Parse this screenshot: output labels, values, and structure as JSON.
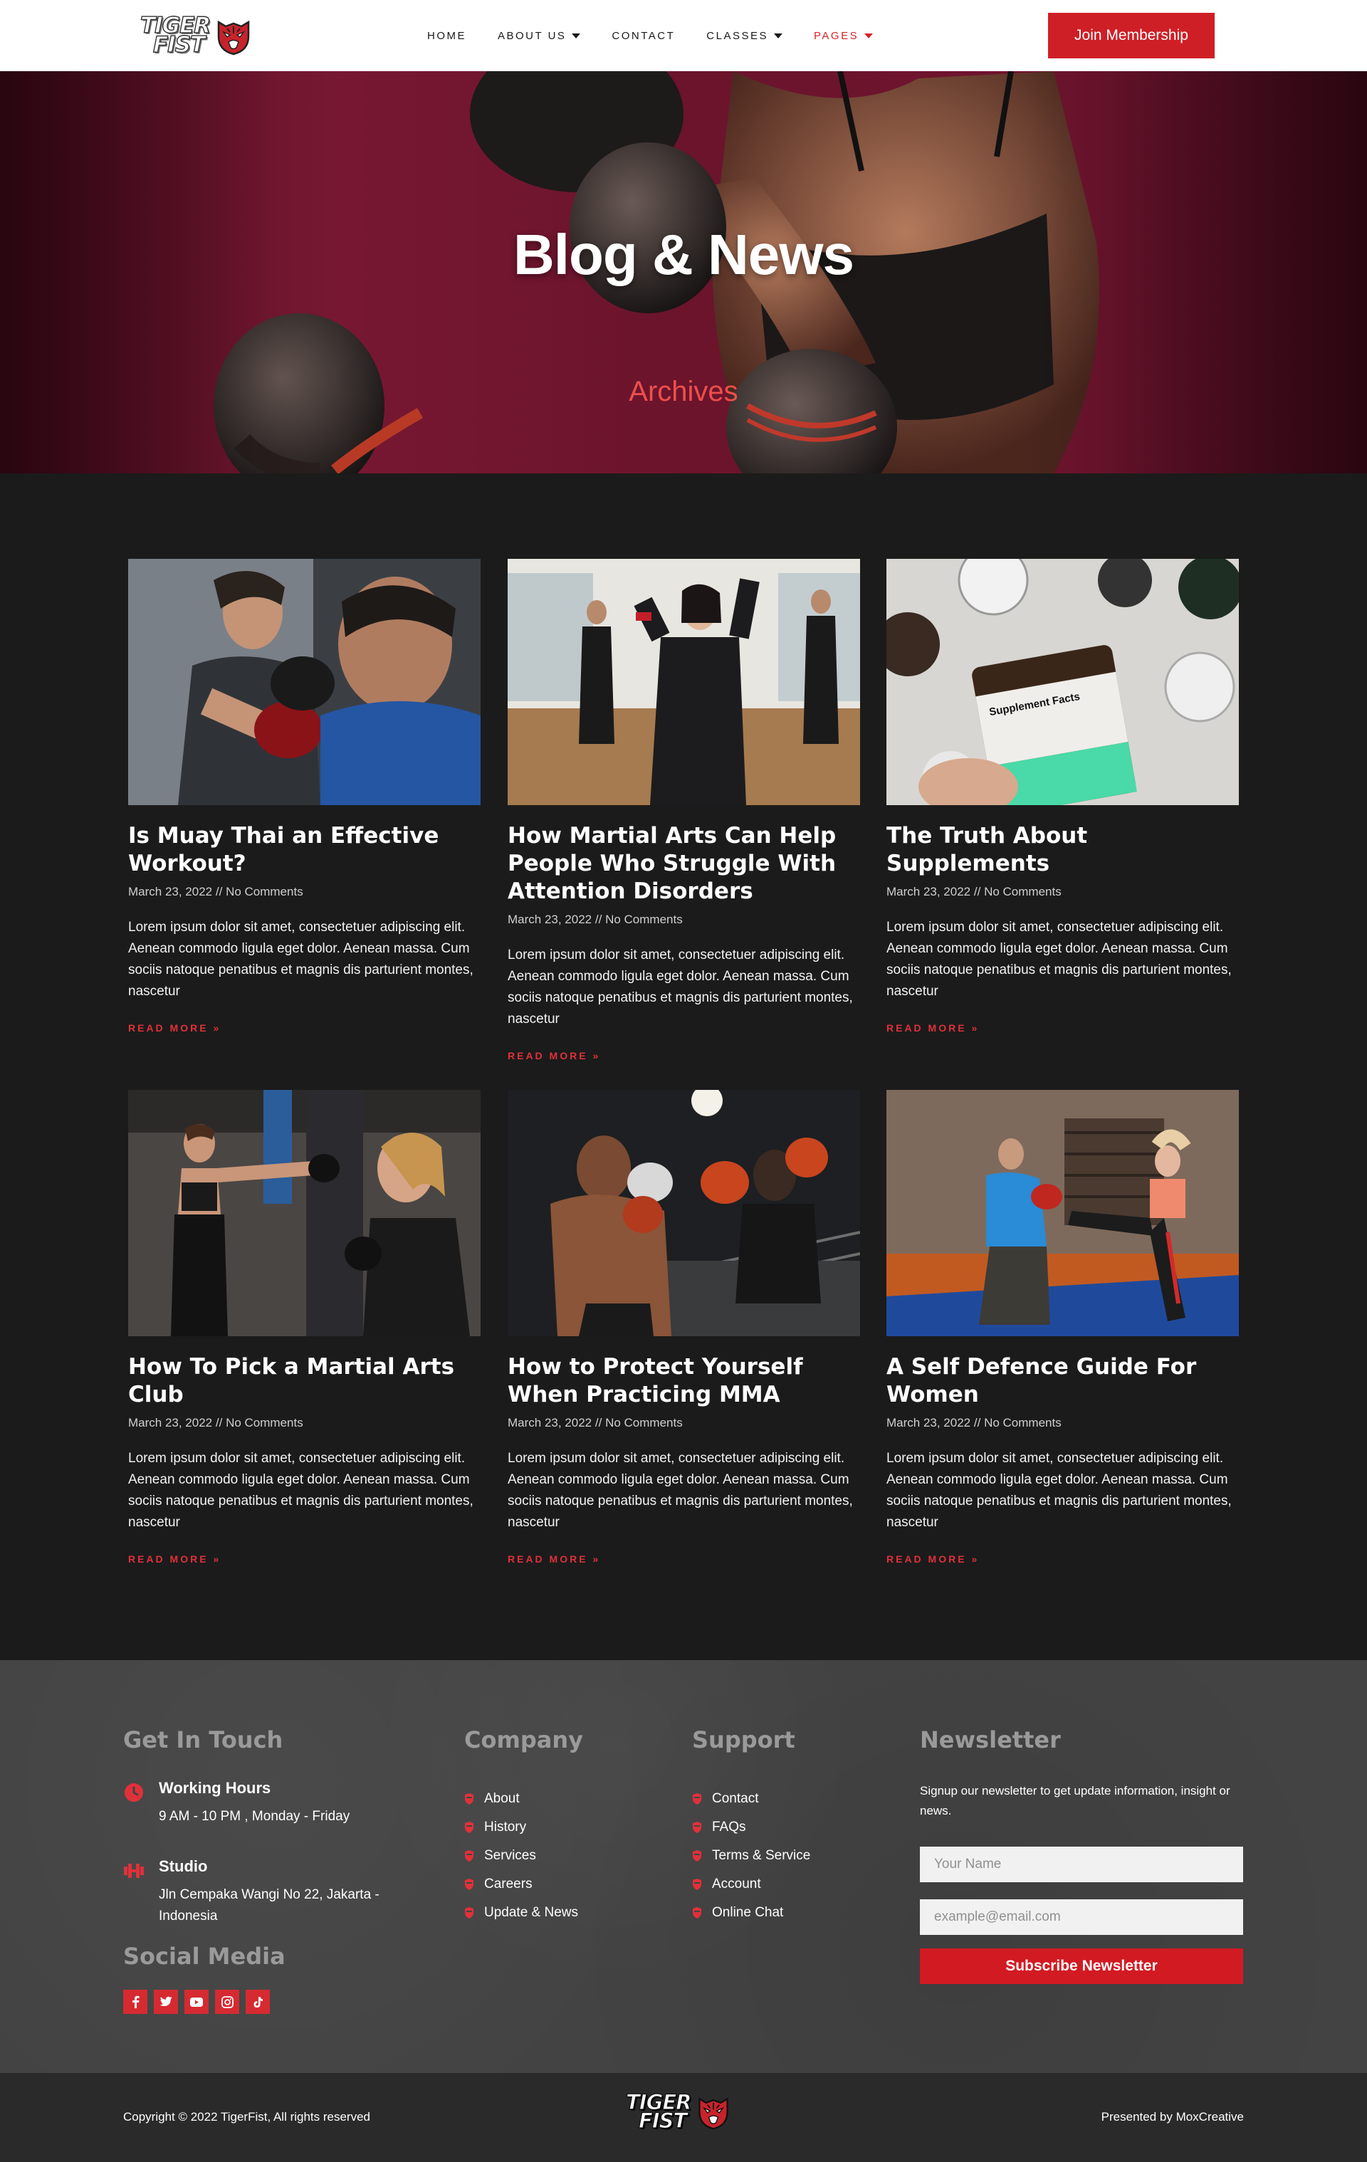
{
  "brand": {
    "line1": "TIGER",
    "line2": "FIST"
  },
  "nav": {
    "items": [
      {
        "label": "HOME",
        "dropdown": false,
        "active": false
      },
      {
        "label": "ABOUT US",
        "dropdown": true,
        "active": false
      },
      {
        "label": "CONTACT",
        "dropdown": false,
        "active": false
      },
      {
        "label": "CLASSES",
        "dropdown": true,
        "active": false
      },
      {
        "label": "PAGES",
        "dropdown": true,
        "active": true
      }
    ],
    "cta": "Join Membership"
  },
  "hero": {
    "title": "Blog & News",
    "subtitle": "Archives"
  },
  "posts": [
    {
      "title": "Is Muay Thai an Effective Workout?",
      "date": "March 23, 2022",
      "sep": "//",
      "comments": "No Comments",
      "excerpt": "Lorem ipsum dolor sit amet, consectetuer adipiscing elit. Aenean commodo ligula eget dolor. Aenean massa. Cum sociis natoque penatibus et magnis dis parturient montes, nascetur",
      "read_more": "READ MORE »"
    },
    {
      "title": "How Martial Arts Can Help People Who Struggle With Attention Disorders",
      "date": "March 23, 2022",
      "sep": "//",
      "comments": "No Comments",
      "excerpt": "Lorem ipsum dolor sit amet, consectetuer adipiscing elit. Aenean commodo ligula eget dolor. Aenean massa. Cum sociis natoque penatibus et magnis dis parturient montes, nascetur",
      "read_more": "READ MORE »"
    },
    {
      "title": "The Truth About Supplements",
      "date": "March 23, 2022",
      "sep": "//",
      "comments": "No Comments",
      "excerpt": "Lorem ipsum dolor sit amet, consectetuer adipiscing elit. Aenean commodo ligula eget dolor. Aenean massa. Cum sociis natoque penatibus et magnis dis parturient montes, nascetur",
      "read_more": "READ MORE »",
      "image_text": "Supplement Facts"
    },
    {
      "title": "How To Pick a Martial Arts Club",
      "date": "March 23, 2022",
      "sep": "//",
      "comments": "No Comments",
      "excerpt": "Lorem ipsum dolor sit amet, consectetuer adipiscing elit. Aenean commodo ligula eget dolor. Aenean massa. Cum sociis natoque penatibus et magnis dis parturient montes, nascetur",
      "read_more": "READ MORE »"
    },
    {
      "title": "How to Protect Yourself When Practicing MMA",
      "date": "March 23, 2022",
      "sep": "//",
      "comments": "No Comments",
      "excerpt": "Lorem ipsum dolor sit amet, consectetuer adipiscing elit. Aenean commodo ligula eget dolor. Aenean massa. Cum sociis natoque penatibus et magnis dis parturient montes, nascetur",
      "read_more": "READ MORE »"
    },
    {
      "title": "A Self Defence Guide For Women",
      "date": "March 23, 2022",
      "sep": "//",
      "comments": "No Comments",
      "excerpt": "Lorem ipsum dolor sit amet, consectetuer adipiscing elit. Aenean commodo ligula eget dolor. Aenean massa. Cum sociis natoque penatibus et magnis dis parturient montes, nascetur",
      "read_more": "READ MORE »"
    }
  ],
  "footer": {
    "contact": {
      "heading": "Get In Touch",
      "hours_title": "Working Hours",
      "hours_text": "9 AM - 10 PM , Monday - Friday",
      "studio_title": "Studio",
      "studio_text": "Jln Cempaka Wangi No 22, Jakarta - Indonesia",
      "social_heading": "Social Media",
      "social_icons": [
        "facebook-icon",
        "twitter-icon",
        "youtube-icon",
        "instagram-icon",
        "tiktok-icon"
      ]
    },
    "company": {
      "heading": "Company",
      "links": [
        "About",
        "History",
        "Services",
        "Careers",
        "Update & News"
      ]
    },
    "support": {
      "heading": "Support",
      "links": [
        "Contact",
        "FAQs",
        "Terms & Service",
        "Account",
        "Online Chat"
      ]
    },
    "newsletter": {
      "heading": "Newsletter",
      "text": "Signup our newsletter to get update information, insight or news.",
      "name_placeholder": "Your Name",
      "email_placeholder": "example@email.com",
      "button": "Subscribe Newsletter"
    },
    "copyright": "Copyright © 2022 TigerFist, All rights reserved",
    "presented": "Presented by MoxCreative"
  },
  "colors": {
    "accent": "#d21a22",
    "hero_bg": "#6b142c",
    "dark_bg": "#1b1b1b",
    "footer_bg": "#434343",
    "bottom_bar": "#2a2a2a"
  }
}
